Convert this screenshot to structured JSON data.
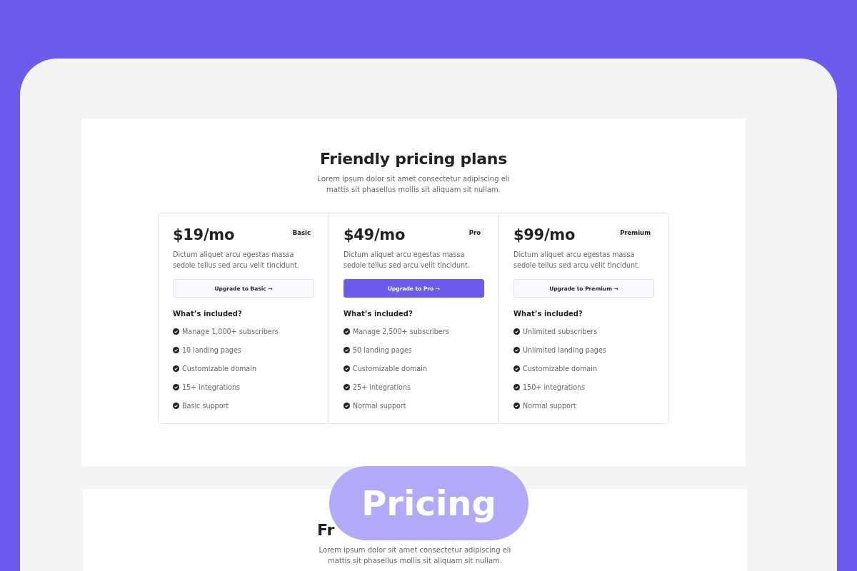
{
  "section": {
    "title": "Friendly pricing plans",
    "subtitle": "Lorem ipsum dolor sit amet consectetur adipiscing eli mattis sit phasellus mollis sit aliquam sit nullam."
  },
  "plans": [
    {
      "price": "$19/mo",
      "badge": "Basic",
      "description": "Dictum aliquet arcu egestas massa sedole tellus sed arcu velit tincidunt.",
      "button": {
        "label": "Upgrade to Basic →",
        "kind": "secondary"
      },
      "features_heading": "What’s included?",
      "features": [
        "Manage 1,000+ subscribers",
        "10 landing pages",
        "Customizable domain",
        "15+ integrations",
        "Basic support"
      ]
    },
    {
      "price": "$49/mo",
      "badge": "Pro",
      "description": "Dictum aliquet arcu egestas massa sedole tellus sed arcu velit tincidunt.",
      "button": {
        "label": "Upgrade to Pro →",
        "kind": "primary"
      },
      "features_heading": "What’s included?",
      "features": [
        "Manage 2,500+ subscribers",
        "50 landing pages",
        "Customizable domain",
        "25+ integrations",
        "Normal support"
      ]
    },
    {
      "price": "$99/mo",
      "badge": "Premium",
      "description": "Dictum aliquet arcu egestas massa sedole tellus sed arcu velit tincidunt.",
      "button": {
        "label": "Upgrade to Premium →",
        "kind": "secondary"
      },
      "features_heading": "What’s included?",
      "features": [
        "Unlimited subscribers",
        "Unlimited landing pages",
        "Customizable domain",
        "150+ integrations",
        "Normal support"
      ]
    }
  ],
  "second_section": {
    "title": "Fr",
    "subtitle": "Lorem ipsum dolor sit amet consectetur adipiscing eli mattis sit phasellus mollis sit aliquam sit nullam."
  },
  "overlay_label": "Pricing"
}
